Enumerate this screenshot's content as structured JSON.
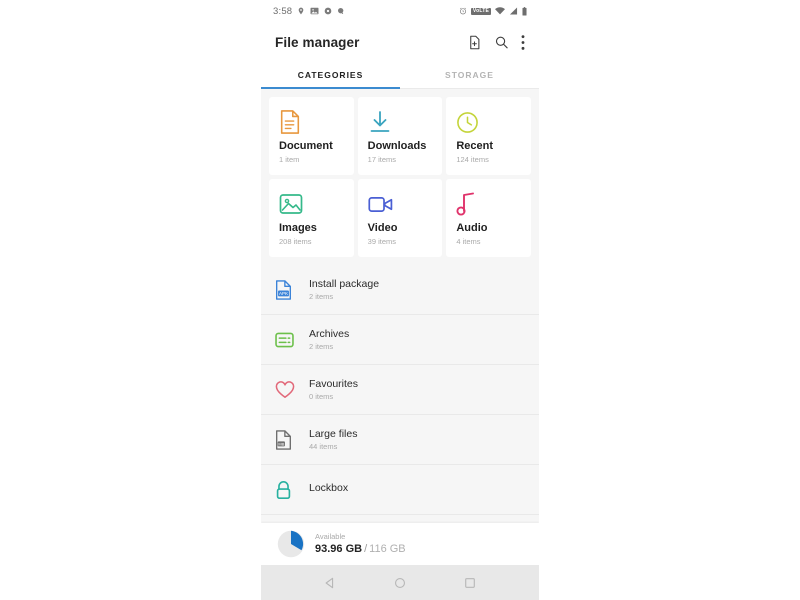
{
  "statusbar": {
    "time": "3:58",
    "left_icons": [
      "location-icon",
      "photo-icon",
      "settings-gear-icon",
      "search-circle-icon"
    ],
    "right_icons": [
      "alarm-icon",
      "volte-icon",
      "wifi-icon",
      "signal-icon",
      "battery-icon"
    ],
    "volte_label": "VoLTE"
  },
  "appbar": {
    "title": "File manager",
    "actions": [
      "add-file-icon",
      "search-icon",
      "more-options-icon"
    ]
  },
  "tabs": [
    {
      "label": "CATEGORIES",
      "active": true
    },
    {
      "label": "STORAGE",
      "active": false
    }
  ],
  "categories": [
    {
      "title": "Document",
      "count": "1 item",
      "icon": "document-icon",
      "color": "#e8983f"
    },
    {
      "title": "Downloads",
      "count": "17 items",
      "icon": "download-icon",
      "color": "#3aa4bf"
    },
    {
      "title": "Recent",
      "count": "124 items",
      "icon": "clock-icon",
      "color": "#c4d43a"
    },
    {
      "title": "Images",
      "count": "208 items",
      "icon": "image-icon",
      "color": "#35b98a"
    },
    {
      "title": "Video",
      "count": "39 items",
      "icon": "video-icon",
      "color": "#4a5fd4"
    },
    {
      "title": "Audio",
      "count": "4 items",
      "icon": "audio-icon",
      "color": "#e0336b"
    }
  ],
  "list": [
    {
      "title": "Install package",
      "count": "2 items",
      "icon": "apk-icon",
      "color": "#3b83d8"
    },
    {
      "title": "Archives",
      "count": "2 items",
      "icon": "archive-icon",
      "color": "#6cc04a"
    },
    {
      "title": "Favourites",
      "count": "0 items",
      "icon": "heart-icon",
      "color": "#e2697a"
    },
    {
      "title": "Large files",
      "count": "44 items",
      "icon": "large-file-icon",
      "color": "#6f6f6f"
    },
    {
      "title": "Lockbox",
      "count": "",
      "icon": "lock-icon",
      "color": "#28b1a0"
    }
  ],
  "storage": {
    "label": "Available",
    "used": "93.96 GB",
    "separator": "/",
    "total": "116 GB",
    "pie_fill_color": "#1a73c4",
    "pie_track_color": "#e4e4e4"
  },
  "navbar": {
    "buttons": [
      "back-icon",
      "home-icon",
      "recents-icon"
    ]
  },
  "theme": {
    "accent": "#3b8bd0",
    "page_bg": "#f6f6f6",
    "card_bg": "#ffffff"
  }
}
